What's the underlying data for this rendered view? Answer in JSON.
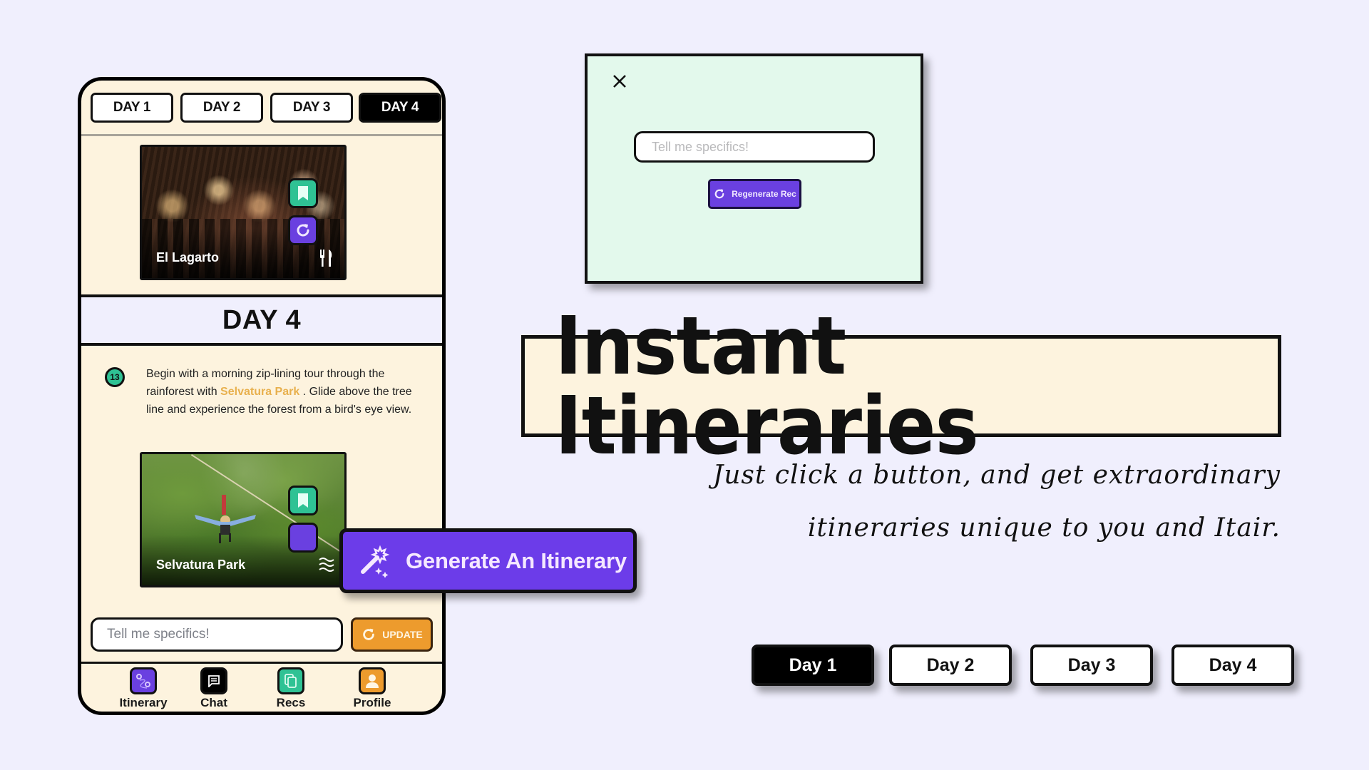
{
  "phone": {
    "tabs": [
      {
        "label": "DAY 1",
        "active": false
      },
      {
        "label": "DAY 2",
        "active": false
      },
      {
        "label": "DAY 3",
        "active": false
      },
      {
        "label": "DAY 4",
        "active": true
      }
    ],
    "cards": [
      {
        "name": "El Lagarto",
        "category_icon": "fork-knife-icon"
      },
      {
        "name": "Selvatura Park",
        "category_icon": "waves-icon"
      }
    ],
    "day_header": "DAY 4",
    "step": {
      "number": "13",
      "text_before": "Begin with a morning zip-lining tour through the rainforest with ",
      "place": "Selvatura Park",
      "text_after": " . Glide above the tree line and experience the forest from a bird's eye view."
    },
    "update": {
      "placeholder": "Tell me specifics!",
      "value": "",
      "button_label": "UPDATE"
    },
    "nav": [
      {
        "label": "Itinerary",
        "icon": "map-route-icon",
        "color": "#6a40e0"
      },
      {
        "label": "Chat",
        "icon": "chat-icon",
        "color": "#000000"
      },
      {
        "label": "Recs",
        "icon": "copy-cards-icon",
        "color": "#2fc294"
      },
      {
        "label": "Profile",
        "icon": "person-icon",
        "color": "#ed9b2d"
      }
    ]
  },
  "generate_button": {
    "label": "Generate An Itinerary",
    "icon": "magic-wand-icon"
  },
  "modal": {
    "placeholder": "Tell me specifics!",
    "value": "",
    "button_label": "Regenerate Rec"
  },
  "headline": {
    "title": "Instant Itineraries",
    "tagline_line1": "Just click a button, and get extraordinary",
    "tagline_line2": "itineraries unique to you and Itair."
  },
  "day_buttons": [
    {
      "label": "Day 1",
      "active": true
    },
    {
      "label": "Day 2",
      "active": false
    },
    {
      "label": "Day 3",
      "active": false
    },
    {
      "label": "Day 4",
      "active": false
    }
  ],
  "colors": {
    "background": "#f0effd",
    "cream": "#fdf3de",
    "purple": "#6c3ce9",
    "green": "#2fc294",
    "orange": "#ed9b2d",
    "mint": "#e3f9ec",
    "place_highlight": "#e8b04d"
  }
}
